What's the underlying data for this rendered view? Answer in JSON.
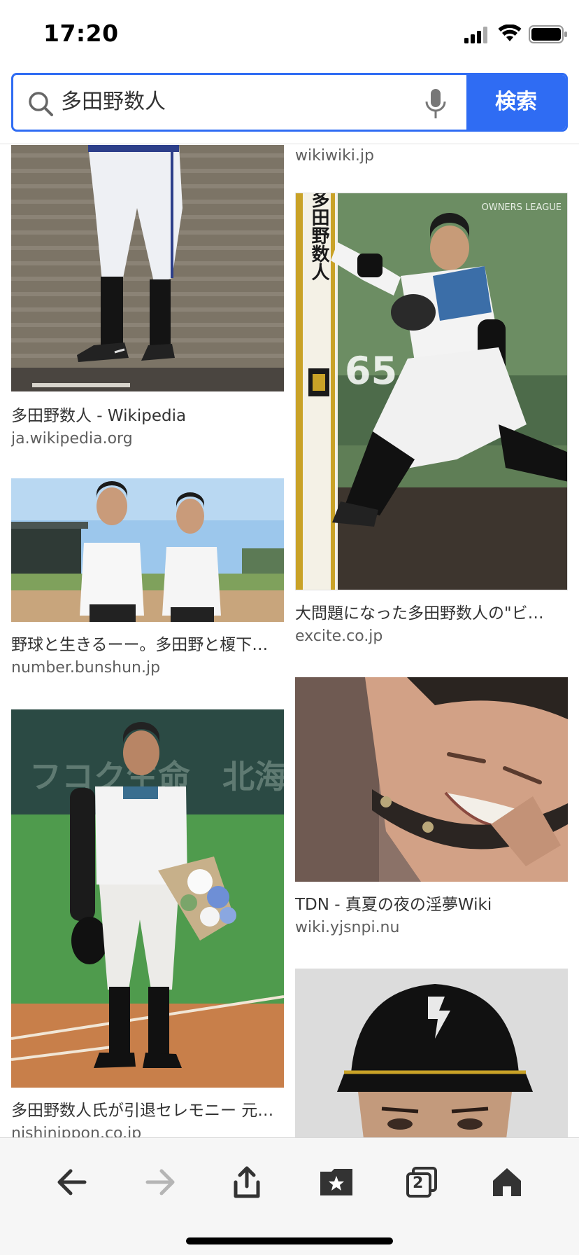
{
  "status_bar": {
    "time": "17:20"
  },
  "search": {
    "query": "多田野数人",
    "button_label": "検索"
  },
  "results": {
    "top_right_source": "wikiwiki.jp",
    "items": [
      {
        "caption": "多田野数人 - Wikipedia",
        "source": "ja.wikipedia.org"
      },
      {
        "caption": "野球と生きるーー。多田野と榎下…",
        "source": "number.bunshun.jp"
      },
      {
        "caption": "多田野数人氏が引退セレモニー 元…",
        "source": "nishinippon.co.jp"
      },
      {
        "caption": "大問題になった多田野数人の\"ビ…",
        "source": "excite.co.jp"
      },
      {
        "caption": "TDN - 真夏の夜の淫夢Wiki",
        "source": "wiki.yjsnpi.nu"
      }
    ],
    "card_texts": {
      "vertical_name": "多田野数人",
      "jersey_number": "65",
      "card_brand": "OWNERS LEAGUE",
      "stadium_ad": "フコク生命　北海"
    }
  },
  "toolbar": {
    "tabs_count": "2"
  },
  "colors": {
    "accent": "#2f6cf3"
  }
}
